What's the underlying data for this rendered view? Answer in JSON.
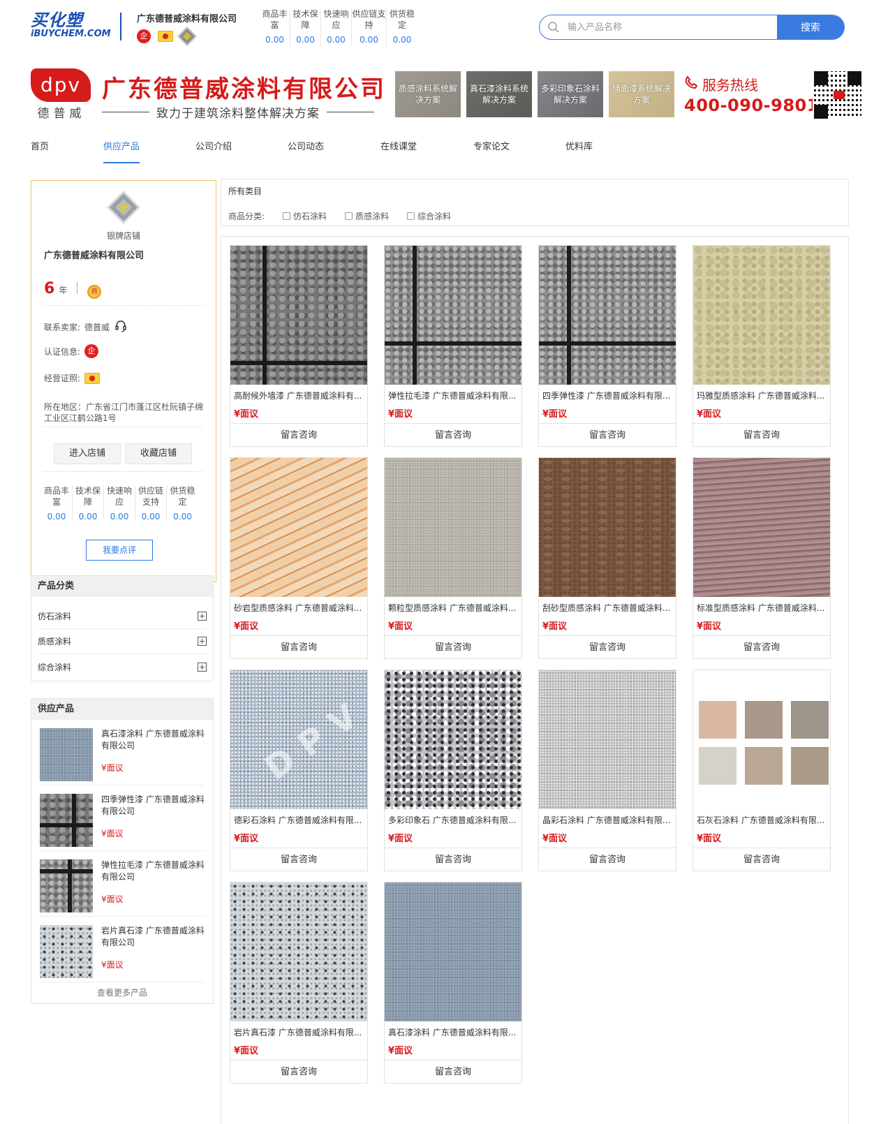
{
  "topbar": {
    "site_logo_cn": "买化塑",
    "site_logo_en": "iBUYCHEM.COM",
    "company": "广东德普威涂料有限公司",
    "badge_enterprise": "企",
    "metrics": [
      {
        "label": "商品丰富",
        "value": "0.00"
      },
      {
        "label": "技术保障",
        "value": "0.00"
      },
      {
        "label": "快速响应",
        "value": "0.00"
      },
      {
        "label": "供应链支持",
        "value": "0.00"
      },
      {
        "label": "供货稳定",
        "value": "0.00"
      }
    ],
    "search_placeholder": "输入产品名称",
    "search_button": "搜索"
  },
  "banner": {
    "logo_mark": "dpv",
    "logo_cn": "德普威",
    "title": "广东德普威涂料有限公司",
    "slogan": "致力于建筑涂料整体解决方案",
    "solutions": [
      "质感涂料系统解决方案",
      "真石漆涂料系统解决方案",
      "多彩印象石涂料解决方案",
      "墙面漆系统解决方案"
    ],
    "hotline_label": "服务热线",
    "hotline_number": "400-090-9801"
  },
  "nav": {
    "items": [
      "首页",
      "供应产品",
      "公司介绍",
      "公司动态",
      "在线课堂",
      "专家论文",
      "优料库"
    ],
    "active": "供应产品"
  },
  "shop": {
    "level_label": "银牌店铺",
    "name": "广东德普威涂料有限公司",
    "years": "6",
    "years_unit": "年",
    "shang_badge": "商",
    "contact_label": "联系卖家:",
    "contact_name": "德普威",
    "cert_label": "认证信息:",
    "license_label": "经营证照:",
    "address": "所在地区：广东省江门市蓬江区杜阮镇子绵工业区江鹤公路1号",
    "enter_button": "进入店铺",
    "favorite_button": "收藏店铺",
    "metrics": [
      {
        "label": "商品丰富",
        "value": "0.00"
      },
      {
        "label": "技术保障",
        "value": "0.00"
      },
      {
        "label": "快速响应",
        "value": "0.00"
      },
      {
        "label": "供应链支持",
        "value": "0.00"
      },
      {
        "label": "供货稳定",
        "value": "0.00"
      }
    ],
    "review_button": "我要点评"
  },
  "category_panel": {
    "title": "产品分类",
    "items": [
      "仿石涂料",
      "质感涂料",
      "综合涂料"
    ]
  },
  "supply_panel": {
    "title": "供应产品",
    "items": [
      {
        "title": "真石漆涂料 广东德普威涂料有限公司",
        "price": "¥面议"
      },
      {
        "title": "四季弹性漆 广东德普威涂料有限公司",
        "price": "¥面议"
      },
      {
        "title": "弹性拉毛漆 广东德普威涂料有限公司",
        "price": "¥面议"
      },
      {
        "title": "岩片真石漆 广东德普威涂料有限公司",
        "price": "¥面议"
      }
    ],
    "more": "查看更多产品"
  },
  "filter": {
    "all_label": "所有类目",
    "category_label": "商品分类:",
    "options": [
      "仿石涂料",
      "质感涂料",
      "综合涂料"
    ]
  },
  "products": [
    {
      "title": "高耐候外墙漆 广东德普威涂料有...",
      "price": "¥面议",
      "consult": "留言咨询",
      "texture": "tile-dark"
    },
    {
      "title": "弹性拉毛漆 广东德普威涂料有限...",
      "price": "¥面议",
      "consult": "留言咨询",
      "texture": "tile-grey"
    },
    {
      "title": "四季弹性漆 广东德普威涂料有限...",
      "price": "¥面议",
      "consult": "留言咨询",
      "texture": "tile-grey"
    },
    {
      "title": "玛雅型质感涂料 广东德普威涂料...",
      "price": "¥面议",
      "consult": "留言咨询",
      "texture": "beige"
    },
    {
      "title": "砂岩型质感涂料 广东德普威涂料...",
      "price": "¥面议",
      "consult": "留言咨询",
      "texture": "wood"
    },
    {
      "title": "颗粒型质感涂料 广东德普威涂料...",
      "price": "¥面议",
      "consult": "留言咨询",
      "texture": "sand"
    },
    {
      "title": "刮砂型质感涂料 广东德普威涂料...",
      "price": "¥面议",
      "consult": "留言咨询",
      "texture": "brown"
    },
    {
      "title": "标准型质感涂料 广东德普威涂料...",
      "price": "¥面议",
      "consult": "留言咨询",
      "texture": "mauve"
    },
    {
      "title": "德彩石涂料 广东德普威涂料有限...",
      "price": "¥面议",
      "consult": "留言咨询",
      "texture": "blue-granite"
    },
    {
      "title": "多彩印象石 广东德普威涂料有限...",
      "price": "¥面议",
      "consult": "留言咨询",
      "texture": "multi"
    },
    {
      "title": "晶彩石涂料 广东德普威涂料有限...",
      "price": "¥面议",
      "consult": "留言咨询",
      "texture": "crystal"
    },
    {
      "title": "石灰石涂料 广东德普威涂料有限...",
      "price": "¥面议",
      "consult": "留言咨询",
      "texture": "swatches"
    },
    {
      "title": "岩片真石漆 广东德普威涂料有限...",
      "price": "¥面议",
      "consult": "留言咨询",
      "texture": "speckle"
    },
    {
      "title": "真石漆涂料 广东德普威涂料有限...",
      "price": "¥面议",
      "consult": "留言咨询",
      "texture": "blue-fine"
    }
  ],
  "watermark_text": "DPV",
  "colors": {
    "brand_red": "#d61b1b",
    "link_blue": "#2a7ae2",
    "site_blue": "#1a4fb3",
    "card_border": "#f0c46a"
  }
}
